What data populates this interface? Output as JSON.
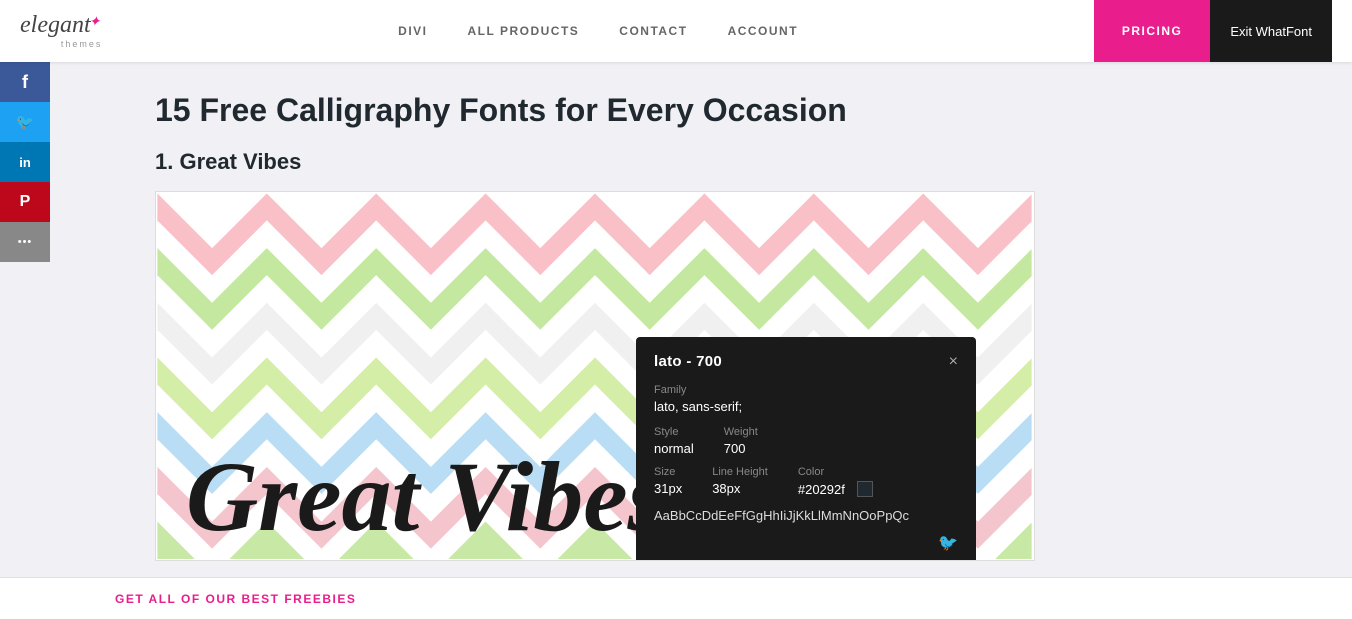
{
  "header": {
    "logo_text": "elegant",
    "logo_sub": "themes",
    "logo_star": "✦",
    "nav": [
      {
        "label": "DIVI",
        "id": "nav-divi"
      },
      {
        "label": "ALL PRODUCTS",
        "id": "nav-all-products"
      },
      {
        "label": "CONTACT",
        "id": "nav-contact"
      },
      {
        "label": "ACCOUNT",
        "id": "nav-account"
      }
    ],
    "pricing_label": "PRICING",
    "exit_whatfont_label": "Exit WhatFont"
  },
  "social": [
    {
      "id": "facebook",
      "icon": "f",
      "label": "Facebook"
    },
    {
      "id": "twitter",
      "icon": "t",
      "label": "Twitter"
    },
    {
      "id": "linkedin",
      "icon": "in",
      "label": "LinkedIn"
    },
    {
      "id": "pinterest",
      "icon": "p",
      "label": "Pinterest"
    },
    {
      "id": "more",
      "icon": "...",
      "label": "More"
    }
  ],
  "page": {
    "title": "15 Free Calligraphy Fonts for Every Occasion",
    "section1_heading": "1. Great Vibes",
    "font_preview_text": "Great Vibes"
  },
  "whatfont_popup": {
    "title": "lato - 700",
    "close": "×",
    "family_label": "Family",
    "family_value": "lato, sans-serif;",
    "style_label": "Style",
    "style_value": "normal",
    "weight_label": "Weight",
    "weight_value": "700",
    "size_label": "Size",
    "size_value": "31px",
    "line_height_label": "Line Height",
    "line_height_value": "38px",
    "color_label": "Color",
    "color_value": "#20292f",
    "color_hex": "#20292f",
    "alphabet": "AaBbCcDdEeFfGgHhIiJjKkLlMmNnOoPpQc"
  },
  "bottom_bar": {
    "link_label": "GET ALL OF OUR BEST FREEBIES"
  }
}
